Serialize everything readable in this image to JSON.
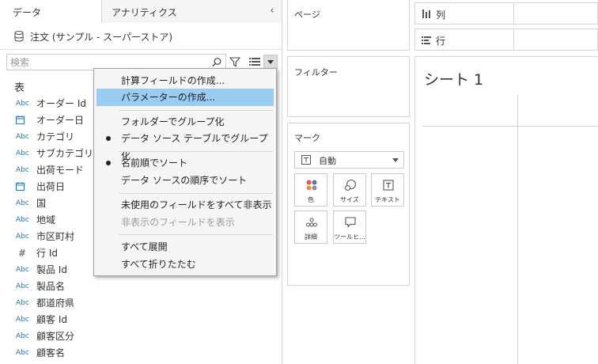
{
  "tabs": {
    "data": "データ",
    "analytics": "アナリティクス"
  },
  "datasource": {
    "name": "注文 (サンプル - スーパーストア)"
  },
  "search": {
    "placeholder": "検索"
  },
  "table_heading": "表",
  "fields": [
    {
      "type": "Abc",
      "name": "オーダー Id"
    },
    {
      "type": "date",
      "name": "オーダー日"
    },
    {
      "type": "Abc",
      "name": "カテゴリ"
    },
    {
      "type": "Abc",
      "name": "サブカテゴリ"
    },
    {
      "type": "Abc",
      "name": "出荷モード"
    },
    {
      "type": "date",
      "name": "出荷日"
    },
    {
      "type": "Abc",
      "name": "国"
    },
    {
      "type": "Abc",
      "name": "地域"
    },
    {
      "type": "Abc",
      "name": "市区町村"
    },
    {
      "type": "#",
      "name": "行 Id"
    },
    {
      "type": "Abc",
      "name": "製品 Id"
    },
    {
      "type": "Abc",
      "name": "製品名"
    },
    {
      "type": "Abc",
      "name": "都道府県"
    },
    {
      "type": "Abc",
      "name": "顧客 Id"
    },
    {
      "type": "Abc",
      "name": "顧客区分"
    },
    {
      "type": "Abc",
      "name": "顧客名"
    }
  ],
  "context_menu": {
    "create_calc": "計算フィールドの作成...",
    "create_param": "パラメーターの作成...",
    "group_by_folder": "フォルダーでグループ化",
    "group_by_table": "データ ソース テーブルでグループ化",
    "sort_by_name": "名前順でソート",
    "sort_by_source": "データ ソースの順序でソート",
    "hide_unused": "未使用のフィールドをすべて非表示",
    "show_hidden": "非表示のフィールドを表示",
    "expand_all": "すべて展開",
    "collapse_all": "すべて折りたたむ"
  },
  "cards": {
    "pages": "ページ",
    "filters": "フィルター",
    "marks": "マーク"
  },
  "marks": {
    "type": "自動",
    "buttons": {
      "color": "色",
      "size": "サイズ",
      "text": "テキスト",
      "detail": "詳細",
      "tooltip": "ツールヒ..."
    }
  },
  "shelves": {
    "columns": "列",
    "rows": "行"
  },
  "sheet": {
    "title": "シート 1"
  },
  "colors": {
    "highlight": "#99ccf0",
    "field_type": "#1f77b4"
  }
}
